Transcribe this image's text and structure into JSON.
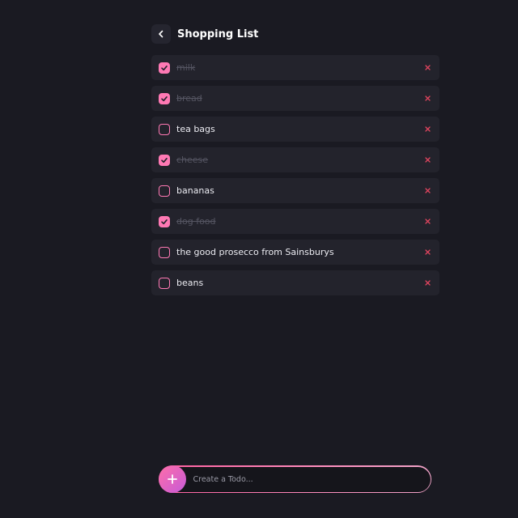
{
  "header": {
    "title": "Shopping List",
    "back_icon": "chevron-left-icon"
  },
  "todos": [
    {
      "label": "milk",
      "done": true
    },
    {
      "label": "bread",
      "done": true
    },
    {
      "label": "tea bags",
      "done": false
    },
    {
      "label": "cheese",
      "done": true
    },
    {
      "label": "bananas",
      "done": false
    },
    {
      "label": "dog food",
      "done": true
    },
    {
      "label": "the good prosecco from Sainsburys",
      "done": false
    },
    {
      "label": "beans",
      "done": false
    }
  ],
  "input": {
    "placeholder": "Create a Todo...",
    "value": "",
    "add_icon": "plus-icon"
  },
  "colors": {
    "background": "#1a1a22",
    "item_background": "#23232c",
    "accent": "#ff79b4",
    "delete": "#e0445f",
    "text": "#ececf2",
    "done_text": "#555562"
  }
}
